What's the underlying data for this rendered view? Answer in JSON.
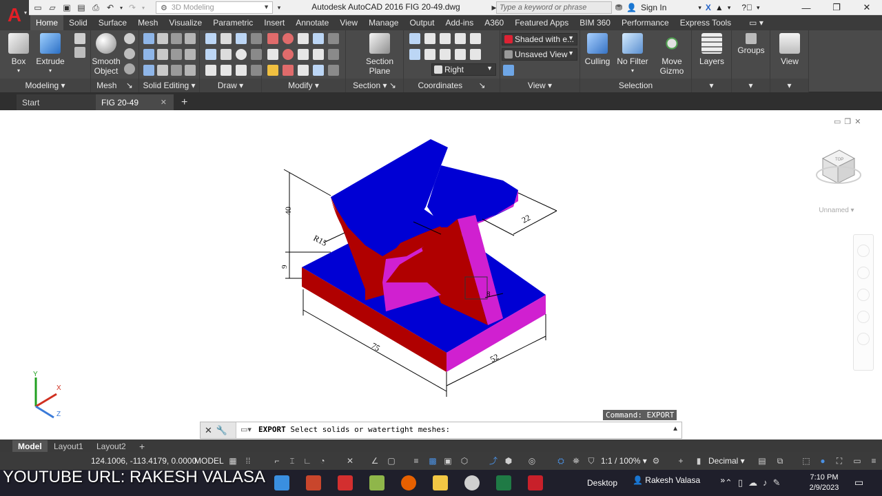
{
  "window": {
    "title": "Autodesk AutoCAD 2016   FIG 20-49.dwg",
    "workspace": "3D Modeling",
    "search_placeholder": "Type a keyword or phrase",
    "sign_in": "Sign In"
  },
  "ribbon_tabs": [
    "Home",
    "Solid",
    "Surface",
    "Mesh",
    "Visualize",
    "Parametric",
    "Insert",
    "Annotate",
    "View",
    "Manage",
    "Output",
    "Add-ins",
    "A360",
    "Featured Apps",
    "BIM 360",
    "Performance",
    "Express Tools"
  ],
  "ribbon": {
    "box_label": "Box",
    "extrude_label": "Extrude",
    "smooth_label_1": "Smooth",
    "smooth_label_2": "Object",
    "section_plane_1": "Section",
    "section_plane_2": "Plane",
    "visual_style": "Shaded with e...",
    "named_view": "Unsaved View",
    "ucs_view": "Right",
    "culling": "Culling",
    "no_filter": "No Filter",
    "move_gizmo_1": "Move",
    "move_gizmo_2": "Gizmo",
    "layers": "Layers",
    "groups": "Groups",
    "view": "View",
    "panels": {
      "modeling": "Modeling",
      "mesh": "Mesh",
      "solid_editing": "Solid Editing",
      "draw": "Draw",
      "modify": "Modify",
      "section": "Section",
      "coordinates": "Coordinates",
      "view": "View",
      "selection": "Selection"
    }
  },
  "file_tabs": {
    "start": "Start",
    "current": "FIG 20-49"
  },
  "drawing": {
    "dims": {
      "d40": "40",
      "r15": "R15",
      "d9": "9",
      "d22": "22",
      "d8": "8",
      "d75": "75",
      "d52": "52"
    },
    "ucs": {
      "x": "X",
      "y": "Y",
      "z": "Z"
    },
    "viewcube_face": "TOP",
    "unnamed": "Unnamed",
    "colors": {
      "blue": "#0000d4",
      "red": "#b00000",
      "magenta": "#d020d0"
    }
  },
  "command": {
    "history": "Command:  EXPORT",
    "keyword": "EXPORT",
    "prompt": "Select solids or watertight meshes:"
  },
  "layout_tabs": [
    "Model",
    "Layout1",
    "Layout2"
  ],
  "status": {
    "coords": "124.1006, -113.4179, 0.0000",
    "space": "MODEL",
    "scale": "1:1 / 100%",
    "units": "Decimal"
  },
  "overlay_text": "YOUTUBE URL: RAKESH VALASA",
  "taskbar": {
    "desktop": "Desktop",
    "user": "Rakesh Valasa",
    "time": "7:10 PM",
    "date": "2/9/2023"
  }
}
